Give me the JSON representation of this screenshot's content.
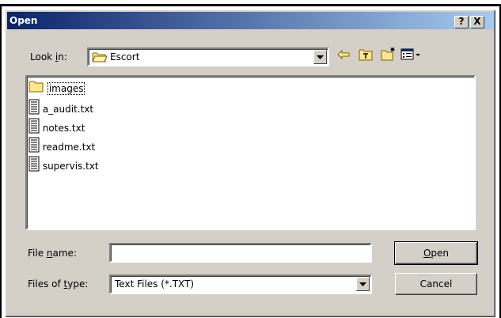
{
  "dialog": {
    "title": "Open",
    "help_glyph": "?",
    "close_glyph": "X"
  },
  "look_in": {
    "label_before": "Look ",
    "label_hotkey": "i",
    "label_after": "n:",
    "value": "Escort",
    "icon": "folder-icon"
  },
  "toolbar": {
    "back_icon": "back-arrow-icon",
    "up_icon": "up-folder-icon",
    "new_folder_icon": "new-folder-icon",
    "view_menu_icon": "view-menu-icon"
  },
  "files": [
    {
      "name": "images",
      "type": "folder"
    },
    {
      "name": "a_audit.txt",
      "type": "text"
    },
    {
      "name": "notes.txt",
      "type": "text"
    },
    {
      "name": "readme.txt",
      "type": "text"
    },
    {
      "name": "supervis.txt",
      "type": "text"
    }
  ],
  "file_name": {
    "label_before": "File ",
    "label_hotkey": "n",
    "label_after": "ame:",
    "value": ""
  },
  "file_type": {
    "label_before": "Files of ",
    "label_hotkey": "t",
    "label_after": "ype:",
    "value": "Text Files (*.TXT)"
  },
  "buttons": {
    "open_hotkey": "O",
    "open_rest": "pen",
    "cancel": "Cancel"
  },
  "colors": {
    "title_start": "#0a246a",
    "title_end": "#a6caf0",
    "face": "#d4d0c8",
    "folder_yellow": "#ffe88c"
  }
}
